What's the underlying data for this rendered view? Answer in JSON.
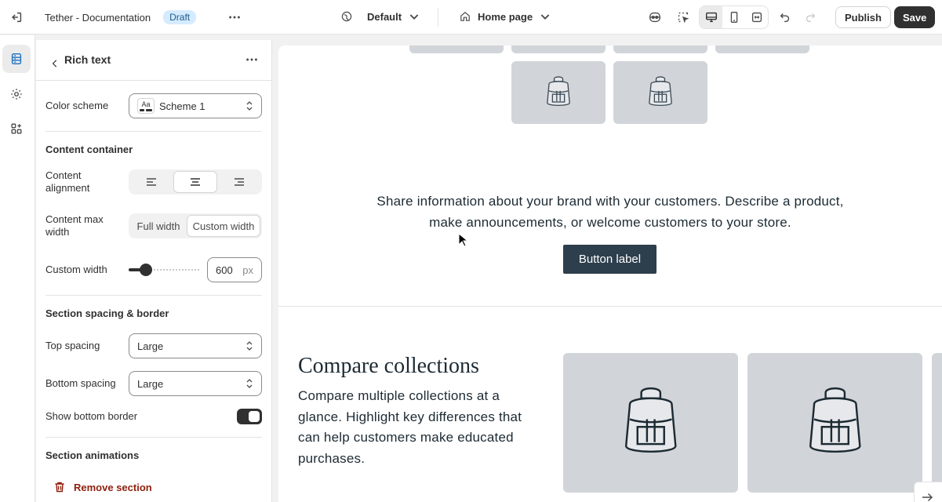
{
  "topbar": {
    "store_title": "Tether - Documentation",
    "status_badge": "Draft",
    "theme_selector": "Default",
    "page_selector": "Home page",
    "publish_label": "Publish",
    "save_label": "Save"
  },
  "panel": {
    "title": "Rich text",
    "color_scheme_label": "Color scheme",
    "color_scheme_value": "Scheme 1",
    "color_scheme_swatch_text": "Aa",
    "content_container_heading": "Content container",
    "content_alignment_label": "Content alignment",
    "content_alignment_selected": "center",
    "content_max_width_label": "Content max width",
    "width_options": [
      "Full width",
      "Custom width"
    ],
    "width_selected": "Custom width",
    "custom_width_label": "Custom width",
    "custom_width_value": "600",
    "custom_width_unit": "px",
    "custom_width_slider_fraction": 0.24,
    "spacing_heading": "Section spacing & border",
    "top_spacing_label": "Top spacing",
    "top_spacing_value": "Large",
    "bottom_spacing_label": "Bottom spacing",
    "bottom_spacing_value": "Large",
    "show_bottom_border_label": "Show bottom border",
    "show_bottom_border_on": true,
    "animations_heading": "Section animations",
    "remove_section_label": "Remove section"
  },
  "preview": {
    "rich_text": "Share information about your brand with your customers. Describe a product, make announcements, or welcome customers to your store.",
    "button_label": "Button label",
    "compare_title": "Compare collections",
    "compare_body": "Compare multiple collections at a glance. Highlight key differences that can help customers make educated purchases."
  },
  "colors": {
    "accent": "#1b6fbf",
    "save_bg": "#303030",
    "draft_badge_bg": "#d5ebff",
    "preview_button_bg": "#2d3e4c",
    "danger": "#8e1f0b",
    "placeholder_bg": "#d1d4d8"
  },
  "icons": [
    "exit-icon",
    "more-icon",
    "globe-icon",
    "home-icon",
    "inspector-icon",
    "select-element-icon",
    "desktop-icon",
    "mobile-icon",
    "fullscreen-icon",
    "undo-icon",
    "redo-icon",
    "sections-icon",
    "settings-icon",
    "apps-icon",
    "back-chevron-icon",
    "trash-icon",
    "arrow-right-icon",
    "backpack-icon"
  ]
}
